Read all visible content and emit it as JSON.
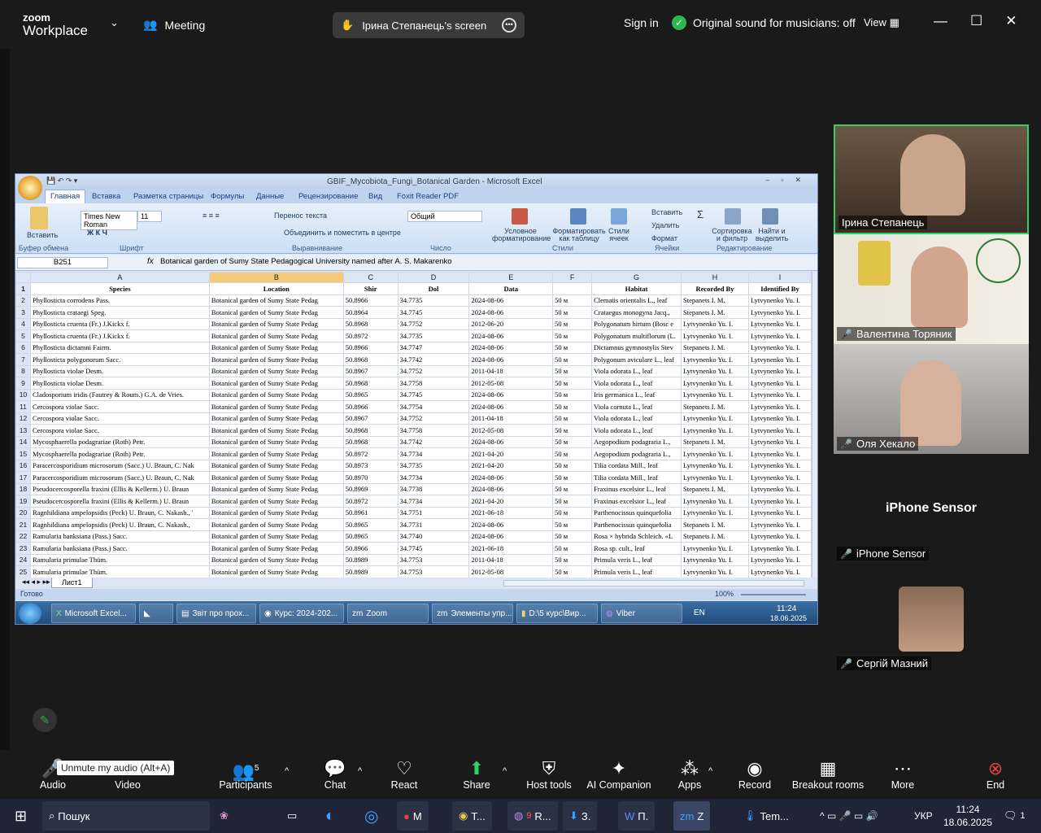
{
  "zoom": {
    "logo_line1": "zoom",
    "logo_line2": "Workplace",
    "meeting_label": "Meeting",
    "share_label": "Ірина Степанець's screen",
    "sign_in": "Sign in",
    "original_sound": "Original sound for musicians: off",
    "view": "View"
  },
  "excel": {
    "title": "GBIF_Mycobiota_Fungi_Botanical Garden - Microsoft Excel",
    "tabs": [
      "Главная",
      "Вставка",
      "Разметка страницы",
      "Формулы",
      "Данные",
      "Рецензирование",
      "Вид",
      "Foxit Reader PDF"
    ],
    "ribbon": {
      "paste": "Вставить",
      "clipboard": "Буфер обмена",
      "font_name": "Times New Roman",
      "font_size": "11",
      "font_group": "Шрифт",
      "wrap": "Перенос текста",
      "merge": "Объединить и поместить в центре",
      "align_group": "Выравнивание",
      "number_format": "Общий",
      "number_group": "Число",
      "cond_format": "Условное форматирование",
      "format_table": "Форматировать как таблицу",
      "cell_styles": "Стили ячеек",
      "styles_group": "Стили",
      "insert": "Вставить",
      "delete": "Удалить",
      "format": "Формат",
      "cells_group": "Ячейки",
      "sort": "Сортировка и фильтр",
      "find": "Найти и выделить",
      "edit_group": "Редактирование"
    },
    "name_box": "B251",
    "fx": "fx",
    "formula": "Botanical garden of Sumy State Pedagogical University named after A. S. Makarenko",
    "col_letters": [
      "A",
      "B",
      "C",
      "D",
      "E",
      "F",
      "G",
      "H",
      "I"
    ],
    "headers": [
      "Species",
      "Location",
      "Shir",
      "Dol",
      "Data",
      "",
      "Habitat",
      "Recorded By",
      "Identified By"
    ],
    "rows": [
      [
        "Phyllosticta corrodens Pass.",
        "Botanical garden of Sumy State Pedag",
        "50.8966",
        "34.7735",
        "2024-08-06",
        "50 м",
        "Clematis orientalis L., leaf",
        "Stepanets I. M.",
        "Lytvynenko Yu. I."
      ],
      [
        "Phyllosticta crataegi Speg.",
        "Botanical garden of Sumy State Pedag",
        "50.8964",
        "34.7745",
        "2024-08-06",
        "50 м",
        "Crataegus monogyna Jacq.,",
        "Stepanets I. M.",
        "Lytvynenko Yu. I."
      ],
      [
        "Phyllosticta cruenta (Fr.) J.Kickx f.",
        "Botanical garden of Sumy State Pedag",
        "50.8968",
        "34.7752",
        "2012-06-20",
        "50 м",
        "Polygonatum hirtum (Bosc e",
        "Lytvynenko Yu. I.",
        "Lytvynenko Yu. I."
      ],
      [
        "Phyllosticta cruenta (Fr.) J.Kickx f.",
        "Botanical garden of Sumy State Pedag",
        "50.8972",
        "34.7735",
        "2024-08-06",
        "50 м",
        "Polygonatum multiflorum (L.",
        "Lytvynenko Yu. I.",
        "Lytvynenko Yu. I."
      ],
      [
        "Phyllosticta dictamni Fairm.",
        "Botanical garden of Sumy State Pedag",
        "50.8966",
        "34.7747",
        "2024-08-06",
        "50 м",
        "Dictamnus gymnostylis Stev",
        "Stepanets I. M.",
        "Lytvynenko Yu. I."
      ],
      [
        "Phyllosticta polygonorum Sacc.",
        "Botanical garden of Sumy State Pedag",
        "50.8968",
        "34.7742",
        "2024-08-06",
        "50 м",
        "Polygonum aviculare L., leaf",
        "Lytvynenko Yu. I.",
        "Lytvynenko Yu. I."
      ],
      [
        "Phyllosticta violae Desm.",
        "Botanical garden of Sumy State Pedag",
        "50.8967",
        "34.7752",
        "2011-04-18",
        "50 м",
        "Viola odorata L., leaf",
        "Lytvynenko Yu. I.",
        "Lytvynenko Yu. I."
      ],
      [
        "Phyllosticta violae Desm.",
        "Botanical garden of Sumy State Pedag",
        "50.8968",
        "34.7758",
        "2012-05-08",
        "50 м",
        "Viola odorata L., leaf",
        "Lytvynenko Yu. I.",
        "Lytvynenko Yu. I."
      ],
      [
        "Cladosporium iridis (Fautrey & Roum.) G.A. de Vries.",
        "Botanical garden of Sumy State Pedag",
        "50.8965",
        "34.7745",
        "2024-08-06",
        "50 м",
        "Iris germanica L., leaf",
        "Lytvynenko Yu. I.",
        "Lytvynenko Yu. I."
      ],
      [
        "Cercospora violae Sacc.",
        "Botanical garden of Sumy State Pedag",
        "50.8966",
        "34.7754",
        "2024-08-06",
        "50 м",
        "Viola cornuta L., leaf",
        "Stepanets I. M.",
        "Lytvynenko Yu. I."
      ],
      [
        "Cercospora violae Sacc.",
        "Botanical garden of Sumy State Pedag",
        "50.8967",
        "34.7752",
        "2011-04-18",
        "50 м",
        "Viola odorata L., leaf",
        "Lytvynenko Yu. I.",
        "Lytvynenko Yu. I."
      ],
      [
        "Cercospora violae Sacc.",
        "Botanical garden of Sumy State Pedag",
        "50.8968",
        "34.7758",
        "2012-05-08",
        "50 м",
        "Viola odorata L., leaf",
        "Lytvynenko Yu. I.",
        "Lytvynenko Yu. I."
      ],
      [
        "Mycosphaerella podagrariae (Roth) Petr.",
        "Botanical garden of Sumy State Pedag",
        "50.8968",
        "34.7742",
        "2024-08-06",
        "50 м",
        "Aegopodium podagraria L.,",
        "Stepanets I. M.",
        "Lytvynenko Yu. I."
      ],
      [
        "Mycosphaerella podagrariae (Roth) Petr.",
        "Botanical garden of Sumy State Pedag",
        "50.8972",
        "34.7734",
        "2021-04-20",
        "50 м",
        "Aegopodium podagraria L.,",
        "Lytvynenko Yu. I.",
        "Lytvynenko Yu. I."
      ],
      [
        "Paracercosporidium microsorum (Sacc.) U. Braun, C. Nak",
        "Botanical garden of Sumy State Pedag",
        "50.8973",
        "34.7735",
        "2021-04-20",
        "50 м",
        "Tilia cordata Mill., leaf",
        "Lytvynenko Yu. I.",
        "Lytvynenko Yu. I."
      ],
      [
        "Paracercosporidium microsorum (Sacc.) U. Braun, C. Nak",
        "Botanical garden of Sumy State Pedag",
        "50.8970",
        "34.7734",
        "2024-08-06",
        "50 м",
        "Tilia cordata Mill., leaf",
        "Lytvynenko Yu. I.",
        "Lytvynenko Yu. I."
      ],
      [
        "Pseudocercosporella fraxini (Ellis & Kellerm.) U. Braun",
        "Botanical garden of Sumy State Pedag",
        "50.8969",
        "34.7738",
        "2024-08-06",
        "50 м",
        "Fraxinus excelsior L., leaf",
        "Stepanets I. M.",
        "Lytvynenko Yu. I."
      ],
      [
        "Pseudocercosporella fraxini (Ellis & Kellerm.) U. Braun",
        "Botanical garden of Sumy State Pedag",
        "50.8972",
        "34.7734",
        "2021-04-20",
        "50 м",
        "Fraxinus excelsior L., leaf",
        "Lytvynenko Yu. I.",
        "Lytvynenko Yu. I."
      ],
      [
        "Ragnhildiana ampelopsidis (Peck) U. Braun, C. Nakash., '",
        "Botanical garden of Sumy State Pedag",
        "50.8961",
        "34.7751",
        "2021-06-18",
        "50 м",
        "Parthenocissus quinquefolia",
        "Lytvynenko Yu. I.",
        "Lytvynenko Yu. I."
      ],
      [
        "Ragnhildiana ampelopsidis (Peck) U. Braun, C. Nakash.,",
        "Botanical garden of Sumy State Pedag",
        "50.8965",
        "34.7731",
        "2024-08-06",
        "50 м",
        "Parthenocissus quinquefolia",
        "Stepanets I. M.",
        "Lytvynenko Yu. I."
      ],
      [
        "Ramularia banksiana (Pass.) Sacc.",
        "Botanical garden of Sumy State Pedag",
        "50.8965",
        "34.7740",
        "2024-08-06",
        "50 м",
        "Rosa × hybrida Schleich. «L",
        "Stepanets I. M.",
        "Lytvynenko Yu. I."
      ],
      [
        "Ramularia banksiana (Pass.) Sacc.",
        "Botanical garden of Sumy State Pedag",
        "50.8966",
        "34.7745",
        "2021-06-18",
        "50 м",
        "Rosa sp. cult., leaf",
        "Lytvynenko Yu. I.",
        "Lytvynenko Yu. I."
      ],
      [
        "Ramularia primulae Thüm.",
        "Botanical garden of Sumy State Pedag",
        "50.8989",
        "34.7753",
        "2011-04-18",
        "50 м",
        "Primula veris L., leaf",
        "Lytvynenko Yu. I.",
        "Lytvynenko Yu. I."
      ],
      [
        "Ramularia primulae Thüm.",
        "Botanical garden of Sumy State Pedag",
        "50.8989",
        "34.7753",
        "2012-05-08",
        "50 м",
        "Primula veris L., leaf",
        "Lytvynenko Yu. I.",
        "Lytvynenko Yu. I."
      ]
    ],
    "sheet_tab": "Лист1",
    "status_ready": "Готово",
    "zoom_level": "100%"
  },
  "guest_taskbar": {
    "items": [
      "Microsoft Excel...",
      "Звіт про прох...",
      "Курс: 2024-202...",
      "Zoom",
      "Элементы упр...",
      "D:\\5 курс\\Вир...",
      "Viber"
    ],
    "lang": "EN",
    "time": "11:24",
    "date": "18.06.2025"
  },
  "participants": [
    {
      "name": "Ірина Степанець",
      "muted": false
    },
    {
      "name": "Валентина Торяник",
      "muted": true
    },
    {
      "name": "Оля Хекало",
      "muted": true
    },
    {
      "name": "iPhone Sensor",
      "muted": true,
      "title": "iPhone Sensor"
    },
    {
      "name": "Сергій Мазний",
      "muted": true
    }
  ],
  "toolbar": {
    "tooltip": "Unmute my audio (Alt+A)",
    "audio": "Audio",
    "video": "Video",
    "participants": "Participants",
    "participants_count": "5",
    "chat": "Chat",
    "react": "React",
    "share": "Share",
    "host_tools": "Host tools",
    "ai": "AI Companion",
    "apps": "Apps",
    "record": "Record",
    "breakout": "Breakout rooms",
    "more": "More",
    "end": "End"
  },
  "host_taskbar": {
    "search": "Пошук",
    "items": [
      "M",
      "T...",
      "R...",
      "З.",
      "П.",
      "Z"
    ],
    "badge": "9",
    "temp": "Tem...",
    "lang": "УКР",
    "time": "11:24",
    "date": "18.06.2025",
    "notif": "1"
  }
}
